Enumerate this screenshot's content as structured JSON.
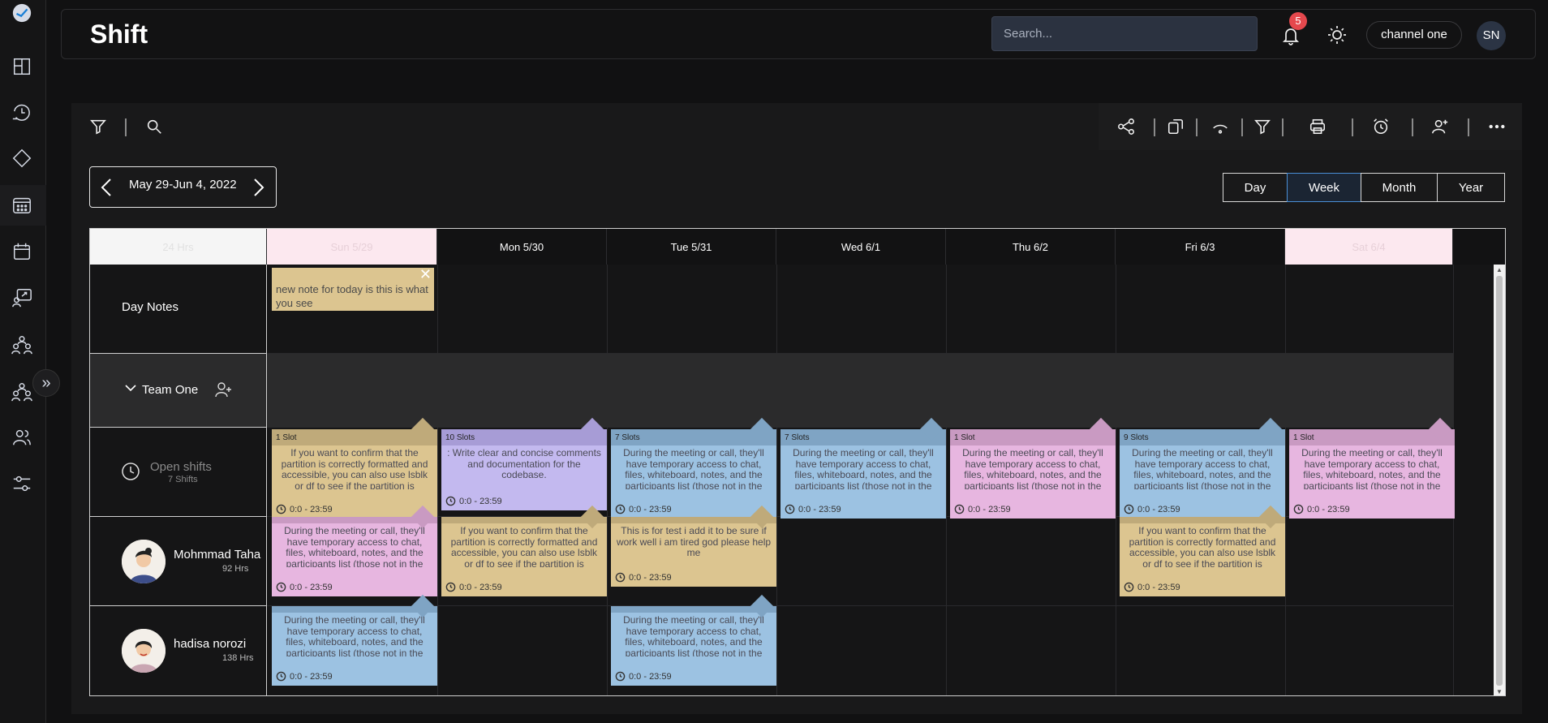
{
  "app": {
    "title": "Shift"
  },
  "header": {
    "search_placeholder": "Search...",
    "notification_count": "5",
    "channel": "channel one",
    "user_initials": "SN"
  },
  "rail": {
    "icons": [
      "logo-icon",
      "dashboard-icon",
      "history-icon",
      "diamond-icon",
      "calendar-grid-icon",
      "calendar-icon",
      "presentation-icon",
      "team-icon",
      "group-icon",
      "users-icon",
      "settings-sliders-icon"
    ],
    "expand": "»"
  },
  "toolbar": {
    "left_icons": [
      "filter-icon",
      "search-icon"
    ],
    "right_icons": [
      "share-icon",
      "copy-icon",
      "wifi-icon",
      "filter-icon",
      "print-icon",
      "alarm-icon",
      "add-user-icon",
      "more-icon"
    ]
  },
  "calendar": {
    "date_range": "May 29-Jun 4, 2022",
    "views": [
      "Day",
      "Week",
      "Month",
      "Year"
    ],
    "active_view": "Week",
    "hours_header": "24 Hrs",
    "days": [
      "Sun 5/29",
      "Mon 5/30",
      "Tue 5/31",
      "Wed 6/1",
      "Thu 6/2",
      "Fri 6/3",
      "Sat 6/4"
    ],
    "day_notes_label": "Day Notes",
    "day_note": "new note for today is this is what you see",
    "team_label": "Team One",
    "open_shifts_label": "Open shifts",
    "open_shifts_count": "7 Shifts",
    "people": [
      {
        "name": "Mohmmad Taha",
        "hours": "92 Hrs"
      },
      {
        "name": "hadisa norozi",
        "hours": "138 Hrs"
      }
    ],
    "open_shifts": [
      {
        "slots": "1 Slot",
        "text": "If you want to confirm that the partition is correctly formatted and accessible, you can also use lsblk or df to see if the partition is mounted pro...",
        "time": "0:0 - 23:59",
        "color": "#dcc590",
        "bar": "#bfaa7a"
      },
      {
        "slots": "10 Slots",
        "text": ": Write clear and concise comments and documentation for the codebase.",
        "time": "0:0 - 23:59",
        "color": "#c3b9ef",
        "bar": "#a79cd6"
      },
      {
        "slots": "7 Slots",
        "text": "During the meeting or call, they'll have temporary access to chat, files, whiteboard, notes, and the participants list (those not in the Outlook in...",
        "time": "0:0 - 23:59",
        "color": "#9cc2e2",
        "bar": "#7fa4c4"
      },
      {
        "slots": "7 Slots",
        "text": "During the meeting or call, they'll have temporary access to chat, files, whiteboard, notes, and the participants list (those not in the Outlook in...",
        "time": "0:0 - 23:59",
        "color": "#9cc2e2",
        "bar": "#7fa4c4"
      },
      {
        "slots": "1 Slot",
        "text": "During the meeting or call, they'll have temporary access to chat, files, whiteboard, notes, and the participants list (those not in the Outlook in...",
        "time": "0:0 - 23:59",
        "color": "#e7b6e0",
        "bar": "#c99ac2"
      },
      {
        "slots": "9 Slots",
        "text": "During the meeting or call, they'll have temporary access to chat, files, whiteboard, notes, and the participants list (those not in the Outlook in...",
        "time": "0:0 - 23:59",
        "color": "#9cc2e2",
        "bar": "#7fa4c4"
      },
      {
        "slots": "1 Slot",
        "text": "During the meeting or call, they'll have temporary access to chat, files, whiteboard, notes, and the participants list (those not in the Outlook in...",
        "time": "0:0 - 23:59",
        "color": "#e7b6e0",
        "bar": "#c99ac2"
      }
    ],
    "taha_shifts": [
      {
        "text": "During the meeting or call, they'll have temporary access to chat, files, whiteboard, notes, and the participants list (those not in the Outlook in...",
        "time": "0:0 - 23:59",
        "color": "#e7b6e0"
      },
      {
        "text": "If you want to confirm that the partition is correctly formatted and accessible, you can also use lsblk or df to see if the partition is mounted prop...",
        "time": "0:0 - 23:59",
        "color": "#dcc590"
      },
      {
        "text": "This is for test i add it to be sure if work well i am tired god please help me",
        "time": "0:0 - 23:59",
        "color": "#dcc590"
      },
      {
        "text": "If you want to confirm that the partition is correctly formatted and accessible, you can also use lsblk or df to see if the partition is mounted prop...",
        "time": "0:0 - 23:59",
        "color": "#dcc590"
      }
    ],
    "hadisa_shifts": [
      {
        "text": "During the meeting or call, they'll have temporary access to chat, files, whiteboard, notes, and the participants list (those not in the Outlook in...",
        "time": "0:0 - 23:59",
        "color": "#9cc2e2"
      },
      {
        "text": "During the meeting or call, they'll have temporary access to chat, files, whiteboard, notes, and the participants list (those not in the Outlook in...",
        "time": "0:0 - 23:59",
        "color": "#9cc2e2"
      }
    ]
  }
}
